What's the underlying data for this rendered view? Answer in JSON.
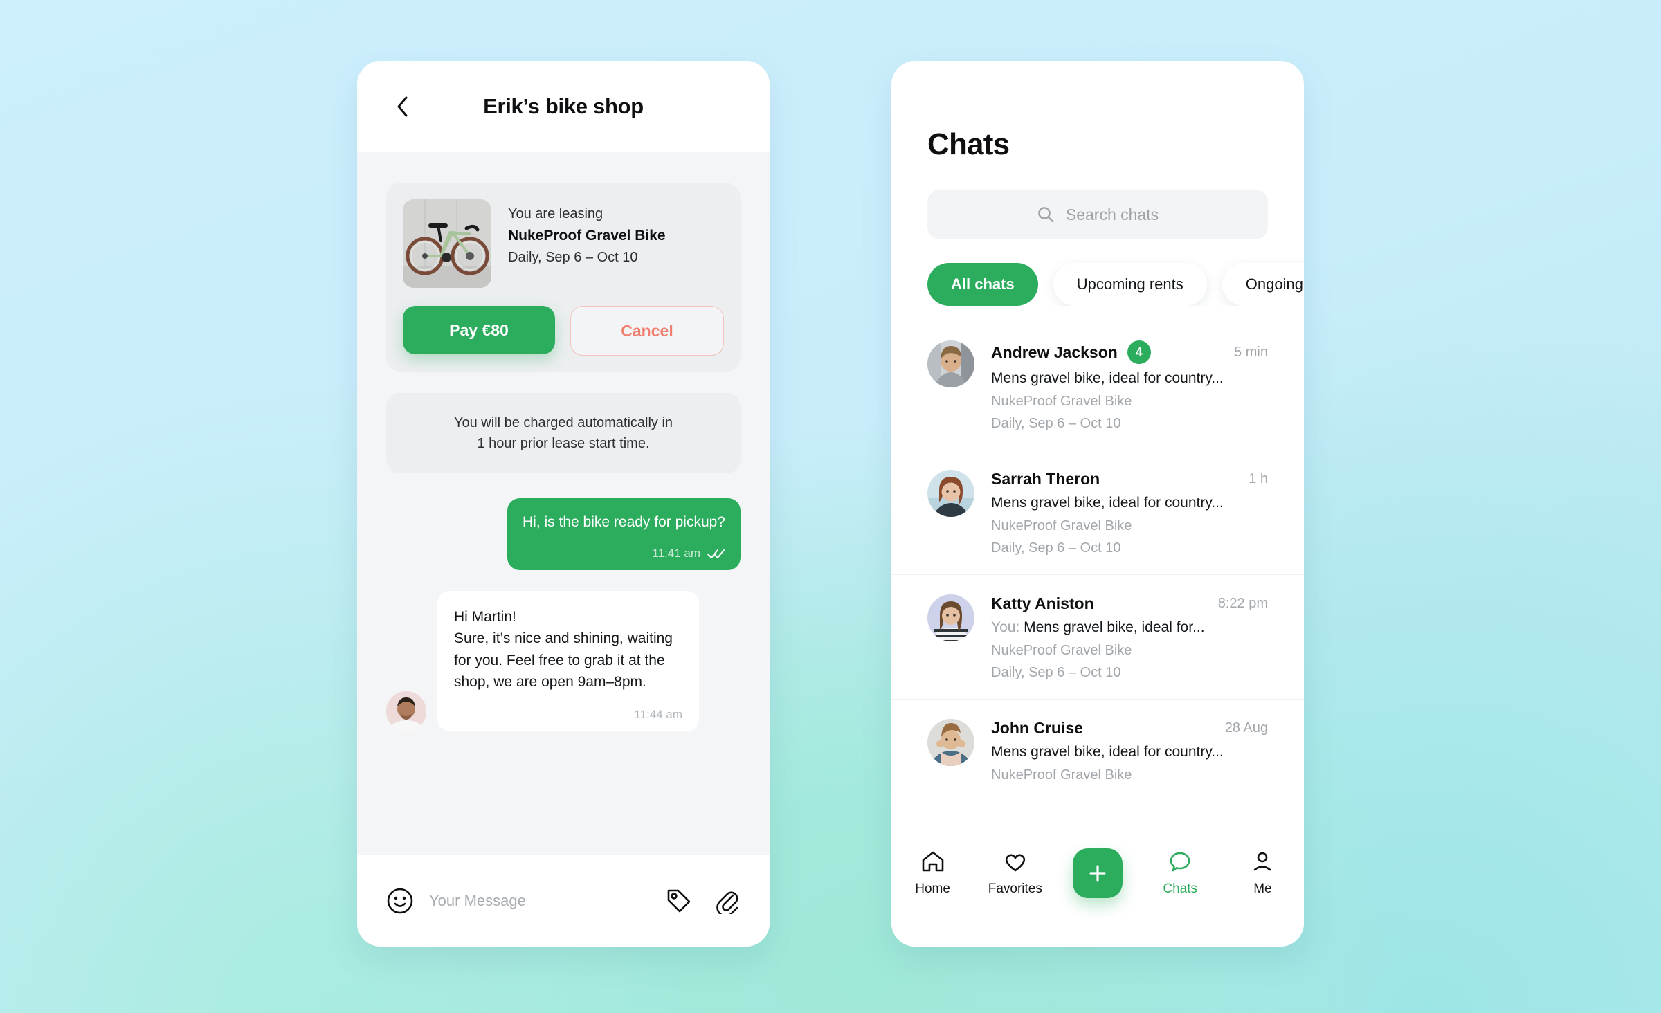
{
  "theme": {
    "brand_green": "#2bad5d",
    "danger_red": "#ef7f6e",
    "bg_blue": "#cceffc",
    "bg_mint": "#a8ece0",
    "muted_text": "#a2a7ac"
  },
  "chat_screen": {
    "back_icon": "chevron-left-icon",
    "title": "Erik’s bike shop",
    "lease_card": {
      "thumb_icon": "bicycle-photo",
      "label": "You are leasing",
      "item": "NukeProof Gravel Bike",
      "period": "Daily, Sep 6 – Oct 10",
      "pay_label": "Pay €80",
      "cancel_label": "Cancel"
    },
    "notice_line1": "You will be charged automatically in",
    "notice_line2": "1 hour prior lease start time.",
    "messages": [
      {
        "direction": "outgoing",
        "text": "Hi, is the bike ready for pickup?",
        "time": "11:41 am",
        "status_icon": "double-check-icon"
      },
      {
        "direction": "incoming",
        "text": "Hi Martin!\nSure, it’s nice and shining, waiting for you. Feel free to grab it at the shop, we are open 9am–8pm.",
        "time": "11:44 am",
        "avatar_icon": "shop-owner-avatar"
      }
    ],
    "composer": {
      "emoji_icon": "smiley-icon",
      "placeholder": "Your Message",
      "tag_icon": "tag-icon",
      "attach_icon": "paperclip-icon"
    }
  },
  "list_screen": {
    "title": "Chats",
    "search": {
      "icon": "search-icon",
      "placeholder": "Search chats"
    },
    "filters": [
      {
        "label": "All chats",
        "active": true
      },
      {
        "label": "Upcoming rents",
        "active": false
      },
      {
        "label": "Ongoing rents",
        "active": false
      }
    ],
    "chats": [
      {
        "avatar_icon": "avatar-andrew",
        "name": "Andrew Jackson",
        "badge": "4",
        "time": "5 min",
        "preview_prefix": "",
        "preview": "Mens gravel bike, ideal for country...",
        "item": "NukeProof Gravel Bike",
        "period": "Daily, Sep 6 – Oct 10"
      },
      {
        "avatar_icon": "avatar-sarrah",
        "name": "Sarrah Theron",
        "badge": "",
        "time": "1 h",
        "preview_prefix": "",
        "preview": "Mens gravel bike, ideal for country...",
        "item": "NukeProof Gravel Bike",
        "period": "Daily, Sep 6 – Oct 10"
      },
      {
        "avatar_icon": "avatar-katty",
        "name": "Katty Aniston",
        "badge": "",
        "time": "8:22 pm",
        "preview_prefix": "You: ",
        "preview": "Mens gravel bike, ideal for...",
        "item": "NukeProof Gravel Bike",
        "period": "Daily, Sep 6 – Oct 10"
      },
      {
        "avatar_icon": "avatar-john",
        "name": "John Cruise",
        "badge": "",
        "time": "28 Aug",
        "preview_prefix": "",
        "preview": "Mens gravel bike, ideal for country...",
        "item": "NukeProof Gravel Bike",
        "period": ""
      }
    ],
    "tabs": [
      {
        "label": "Home",
        "icon": "home-icon",
        "active": false
      },
      {
        "label": "Favorites",
        "icon": "heart-icon",
        "active": false
      },
      {
        "label": "",
        "icon": "plus-icon",
        "active": false,
        "is_fab": true
      },
      {
        "label": "Chats",
        "icon": "chat-bubble-icon",
        "active": true
      },
      {
        "label": "Me",
        "icon": "person-icon",
        "active": false
      }
    ]
  }
}
